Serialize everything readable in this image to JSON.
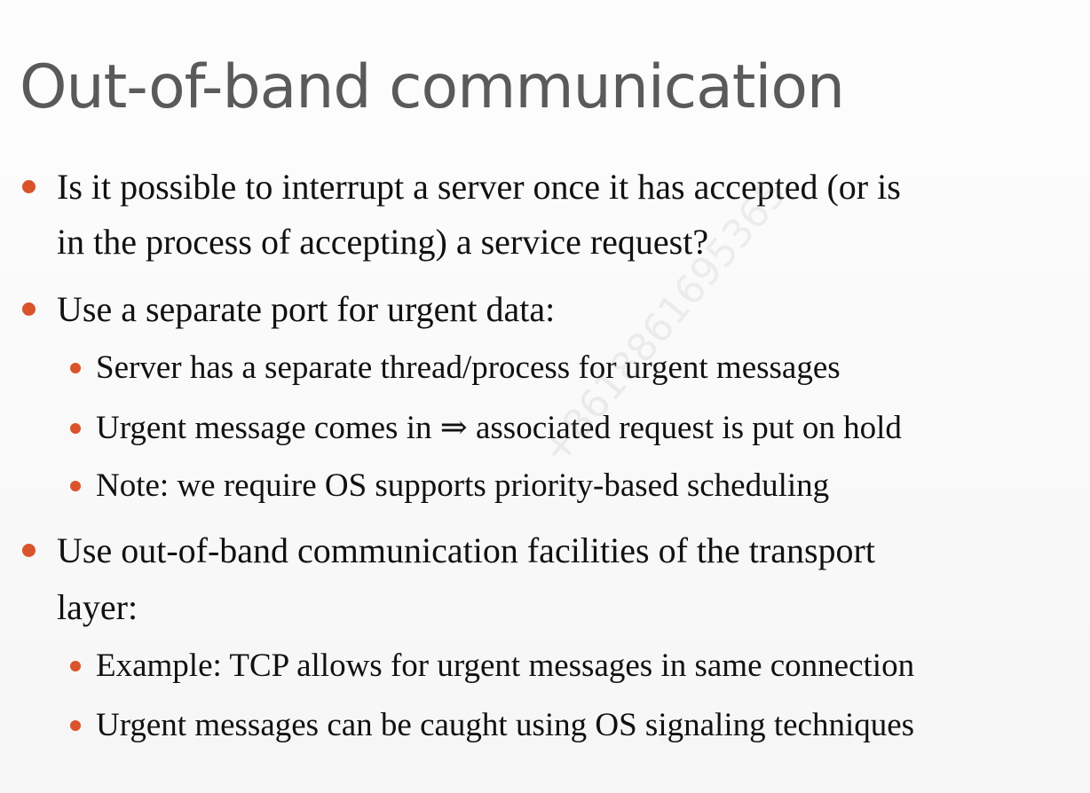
{
  "slide": {
    "title": "Out-of-band communication",
    "bullets": [
      {
        "text_line1": "Is it possible to interrupt a server once it has accepted (or is",
        "text_line2": "in the process of accepting) a service request?"
      },
      {
        "text_line1": "Use a separate port for urgent data:",
        "subbullets": [
          "Server has a separate thread/process for urgent messages",
          "Urgent message comes in ⇒ associated request is put on hold",
          "Note: we require OS supports priority-based scheduling"
        ]
      },
      {
        "text_line1": "Use out-of-band communication facilities of the transport",
        "text_line2": "layer:",
        "subbullets": [
          "Example: TCP allows for urgent messages in same connection",
          "Urgent messages can be caught using OS signaling techniques"
        ]
      }
    ]
  },
  "watermark": "+8618861695365",
  "colors": {
    "title": "#5a5a5a",
    "bullet_marker": "#d9542b",
    "body_text": "#111111"
  }
}
